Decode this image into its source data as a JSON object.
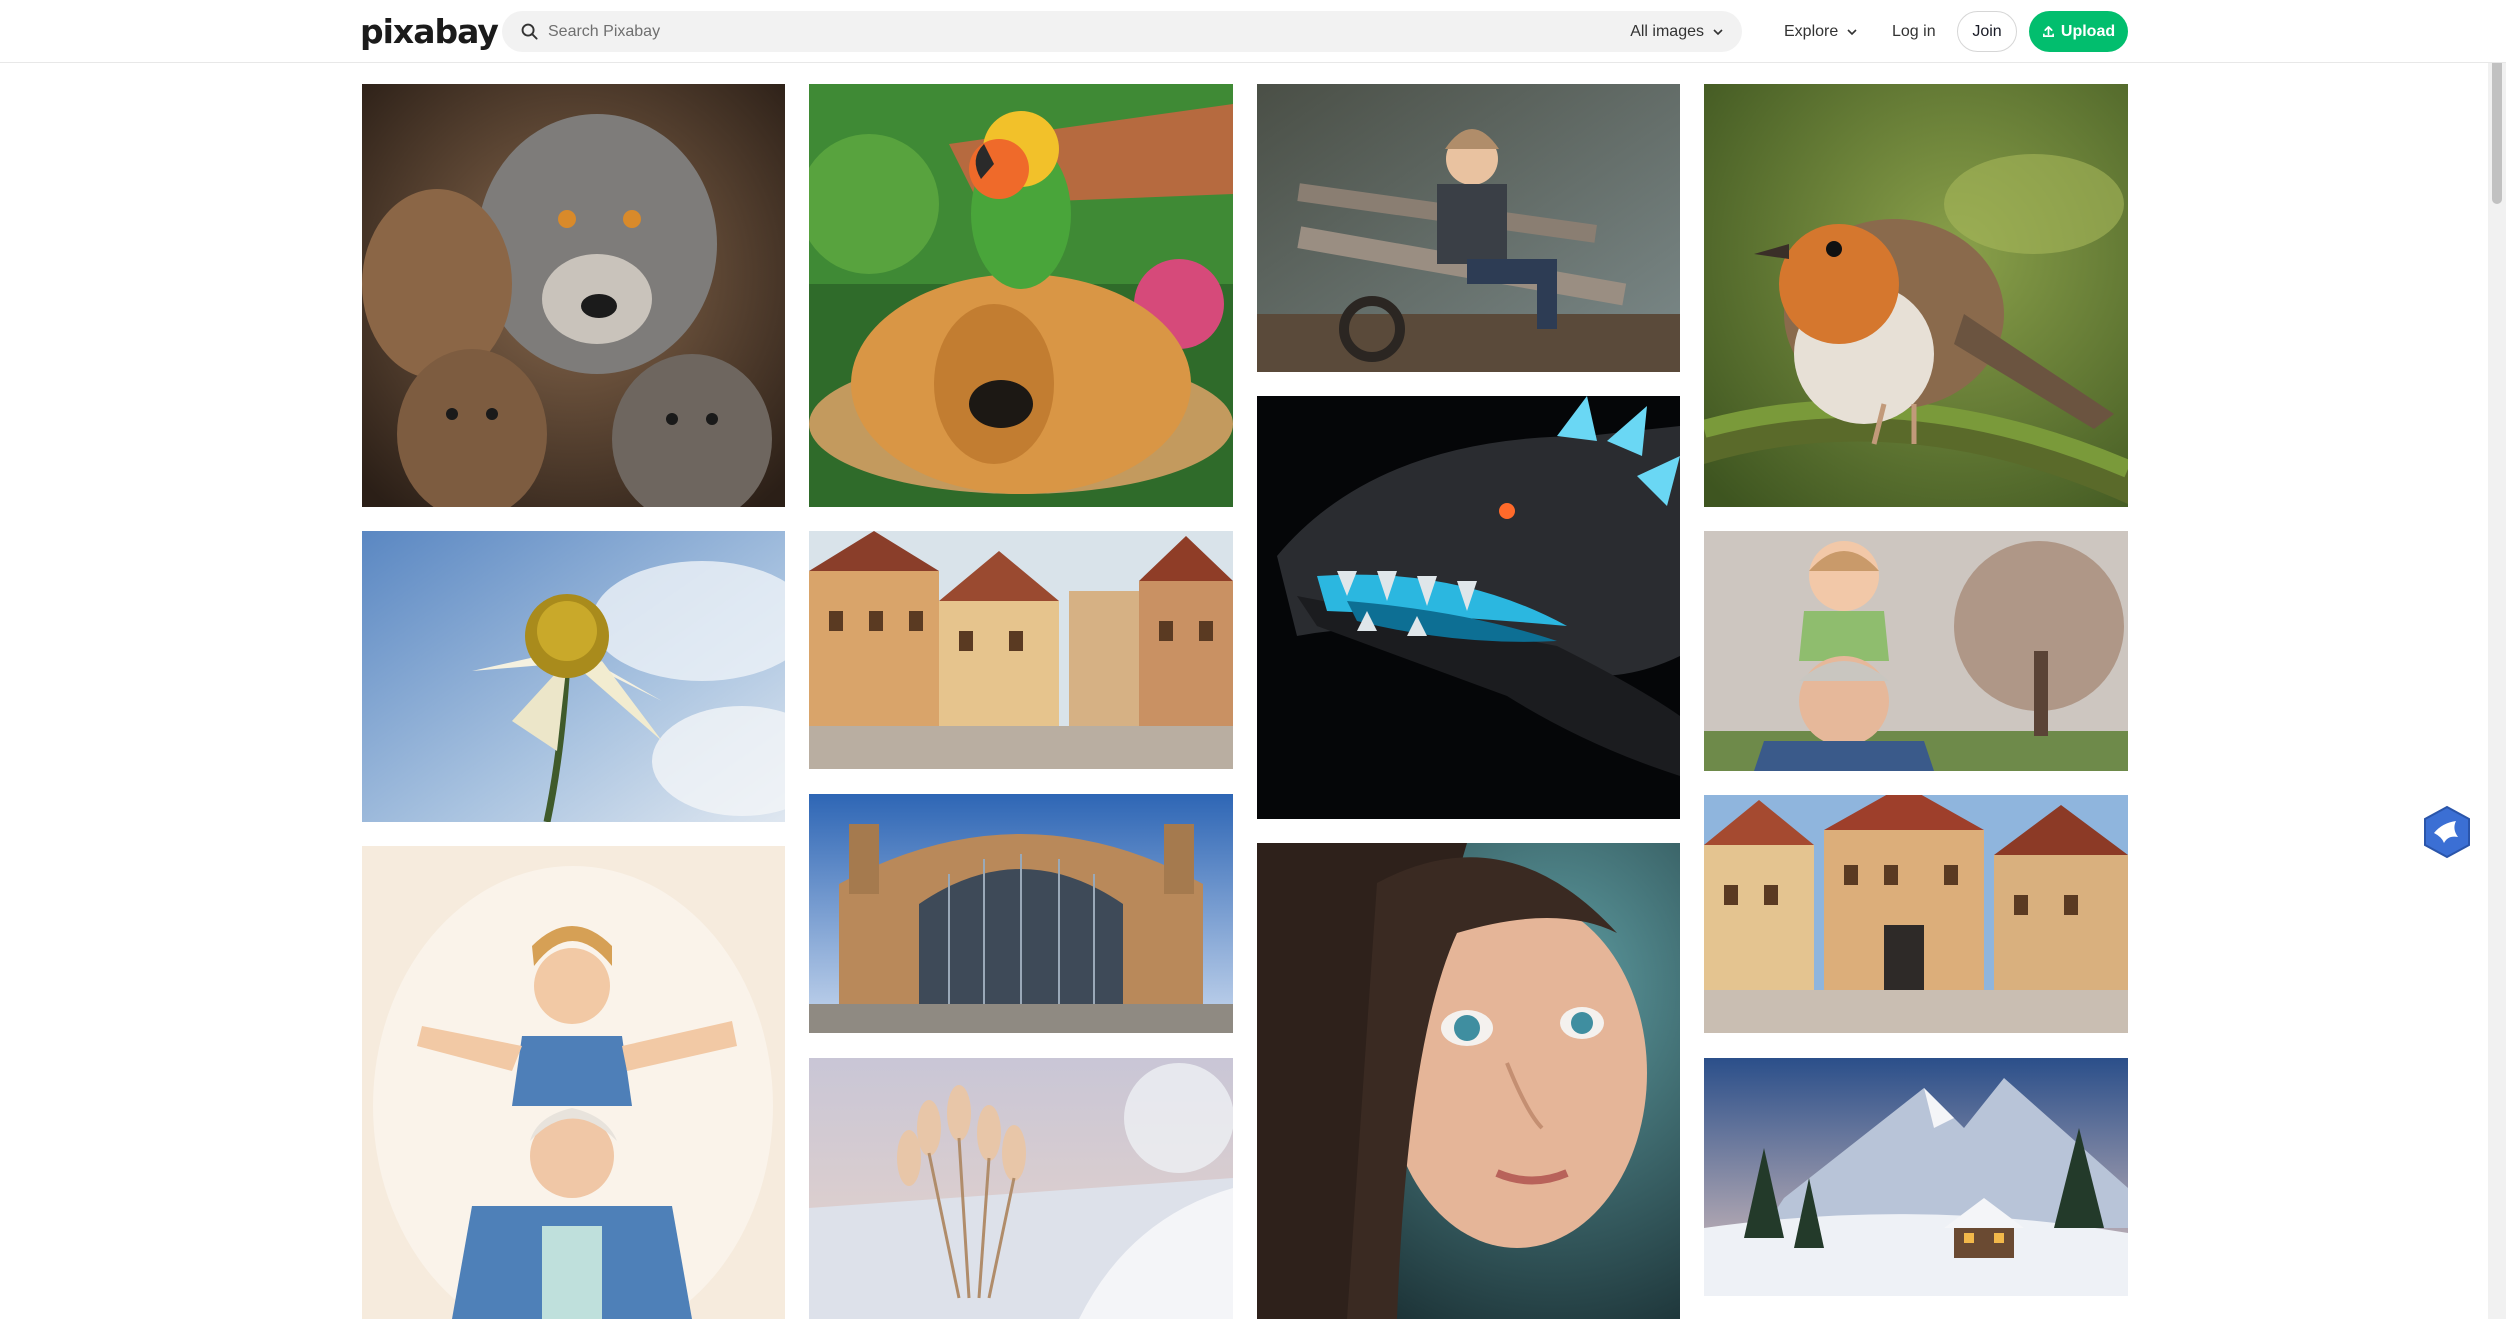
{
  "header": {
    "logo_text": "pixabay",
    "search_placeholder": "Search Pixabay",
    "filter_label": "All images",
    "explore_label": "Explore",
    "login_label": "Log in",
    "join_label": "Join",
    "upload_label": "Upload"
  },
  "colors": {
    "brand_green": "#02be6e",
    "text_dark": "#191b26",
    "search_bg": "#f2f2f2"
  },
  "icons": {
    "search": "search-icon",
    "chevron": "chevron-down-icon",
    "upload": "upload-icon",
    "badge": "chat-bird-icon"
  },
  "photos": [
    {
      "id": "wolves",
      "subject": "wolf family"
    },
    {
      "id": "parrot-dog",
      "subject": "parrot on dog"
    },
    {
      "id": "child-bench",
      "subject": "child on bench"
    },
    {
      "id": "robin",
      "subject": "robin on branch"
    },
    {
      "id": "flower",
      "subject": "white coneflower"
    },
    {
      "id": "town-1",
      "subject": "half-timbered town"
    },
    {
      "id": "dragon",
      "subject": "dragon head"
    },
    {
      "id": "grandpa-child",
      "subject": "child on grandfather's shoulders"
    },
    {
      "id": "grandma-child",
      "subject": "child on grandmother's shoulders"
    },
    {
      "id": "station",
      "subject": "train station"
    },
    {
      "id": "girl",
      "subject": "girl portrait"
    },
    {
      "id": "town-2",
      "subject": "half-timbered street"
    },
    {
      "id": "winter-reeds",
      "subject": "frosted reeds by river"
    },
    {
      "id": "winter-cabin",
      "subject": "snowy mountain cabin"
    }
  ]
}
